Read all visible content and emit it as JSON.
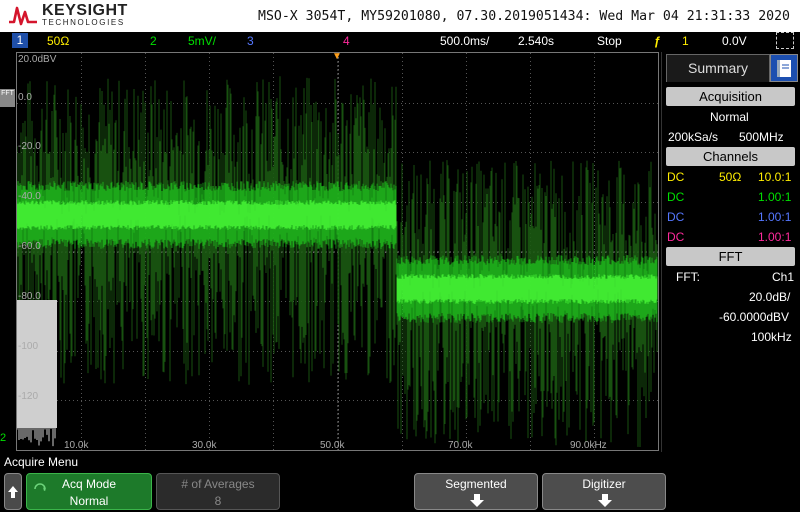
{
  "header": {
    "brand": "KEYSIGHT",
    "brand_sub": "TECHNOLOGIES",
    "title": "MSO-X 3054T, MY59201080, 07.30.2019051434: Wed Mar 04 21:31:33 2020"
  },
  "status_bar": {
    "ch1_num": "1",
    "ch1_impedance": "50Ω",
    "ch2_num": "2",
    "ch2_scale": "5mV/",
    "ch3_num": "3",
    "ch4_num": "4",
    "timebase": "500.0ms/",
    "delay": "2.540s",
    "run_state": "Stop",
    "trigger_icon": "trigger-edge-icon",
    "trigger_channel": "1",
    "trigger_level": "0.0V"
  },
  "graticule": {
    "y_labels": [
      "20.0dBV",
      "0.0",
      "-20.0",
      "-40.0",
      "-60.0",
      "-80.0",
      "-100",
      "-120"
    ],
    "x_labels": [
      "10.0k",
      "30.0k",
      "50.0k",
      "70.0k",
      "90.0kHz"
    ],
    "fft_tag": "FFT",
    "ch2_ground": "2"
  },
  "panel": {
    "tab_label": "Summary",
    "acquisition_header": "Acquisition",
    "acquisition_mode": "Normal",
    "sample_rate": "200kSa/s",
    "bandwidth": "500MHz",
    "channels_header": "Channels",
    "channels": [
      {
        "coupling": "DC",
        "impedance": "50Ω",
        "probe": "10.0:1",
        "color": "#ffee00"
      },
      {
        "coupling": "DC",
        "impedance": "",
        "probe": "1.00:1",
        "color": "#00e000"
      },
      {
        "coupling": "DC",
        "impedance": "",
        "probe": "1.00:1",
        "color": "#5577ff"
      },
      {
        "coupling": "DC",
        "impedance": "",
        "probe": "1.00:1",
        "color": "#ff2a9c"
      }
    ],
    "fft_header": "FFT",
    "fft_label": "FFT:",
    "fft_source": "Ch1",
    "fft_scale": "20.0dB/",
    "fft_offset": "-60.0000dBV",
    "fft_span": "100kHz"
  },
  "menu": {
    "title": "Acquire Menu",
    "back_icon": "up-arrow-icon",
    "acq_mode_label": "Acq Mode",
    "acq_mode_value": "Normal",
    "averages_label": "# of Averages",
    "averages_value": "8",
    "segmented_label": "Segmented",
    "digitizer_label": "Digitizer"
  },
  "colors": {
    "trace": "#22ee22",
    "grid": "#555555",
    "channel1": "#ffee00",
    "channel2": "#00e000",
    "channel3": "#5577ff",
    "channel4": "#ff2a9c",
    "accent_blue": "#1c4fb0",
    "softkey_active": "#1d7a2a"
  }
}
